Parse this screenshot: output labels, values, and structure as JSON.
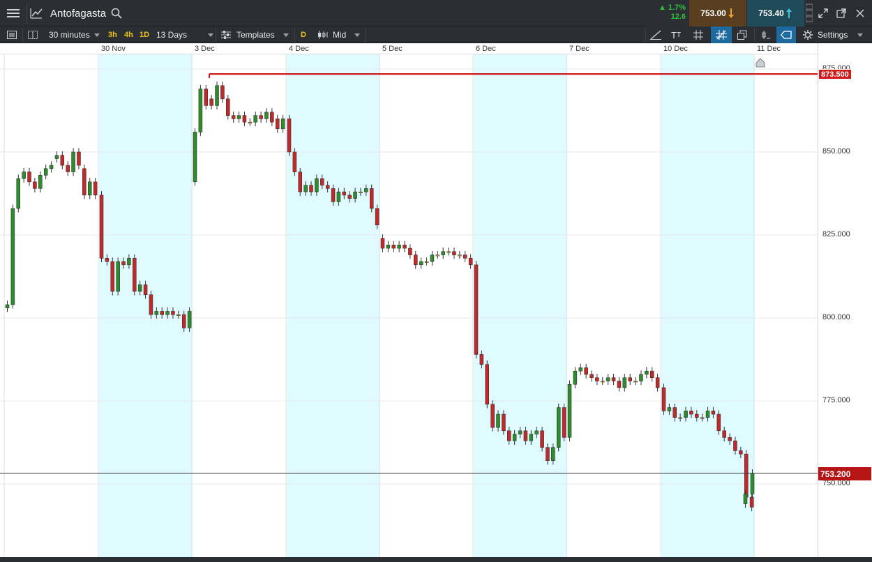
{
  "header": {
    "instrument": "Antofagasta",
    "change_pct": "▲ 1.7%",
    "change_abs": "12.6",
    "sell_price": "753.00",
    "buy_price": "753.40"
  },
  "toolbar": {
    "interval": "30 minutes",
    "quick_3h": "3h",
    "quick_4h": "4h",
    "quick_1d": "1D",
    "range": "13 Days",
    "templates": "Templates",
    "d_badge": "D",
    "price_type": "Mid",
    "settings": "Settings"
  },
  "chart_data": {
    "type": "candlestick",
    "date_labels": [
      "30 Nov",
      "3 Dec",
      "4 Dec",
      "5 Dec",
      "6 Dec",
      "7 Dec",
      "10 Dec",
      "11 Dec"
    ],
    "price_ticks": [
      "875.000",
      "850.000",
      "825.000",
      "800.000",
      "775.000",
      "750.000"
    ],
    "ylim": [
      736,
      880
    ],
    "resistance_line": {
      "value": 873.5,
      "label": "873.500"
    },
    "current_price": {
      "value": 753.2,
      "label": "753.200"
    },
    "colors": {
      "up": "#2e8b2e",
      "down": "#c12a2a",
      "doji": "#e0a040",
      "shade": "#e0fbff",
      "line": "#d11a1a"
    },
    "days": [
      {
        "o": [
          803,
          804,
          833,
          842,
          844,
          841,
          839,
          843,
          845,
          848,
          849,
          846,
          844,
          850,
          845,
          837,
          841
        ],
        "c": [
          804,
          833,
          842,
          844,
          841,
          839,
          843,
          845,
          846,
          849,
          846,
          844,
          850,
          846,
          837,
          841,
          837
        ]
      },
      {
        "o": [
          837,
          818,
          817,
          808,
          817,
          816,
          818,
          808,
          810,
          807,
          801,
          802,
          801,
          802,
          801,
          801,
          797
        ],
        "c": [
          818,
          817,
          808,
          817,
          816,
          818,
          808,
          810,
          807,
          801,
          802,
          801,
          802,
          801,
          801,
          797,
          802
        ]
      },
      {
        "o": [
          841,
          856,
          869,
          866,
          864,
          870,
          866,
          861,
          860,
          861,
          859,
          859,
          861,
          860,
          862,
          860,
          857
        ],
        "c": [
          856,
          869,
          864,
          864,
          870,
          866,
          861,
          860,
          861,
          859,
          859,
          861,
          860,
          862,
          859,
          857,
          860
        ]
      },
      {
        "o": [
          860,
          850,
          844,
          838,
          840,
          838,
          842,
          840,
          839,
          835,
          838,
          837,
          836,
          838,
          838,
          839,
          833
        ],
        "c": [
          850,
          844,
          838,
          840,
          838,
          842,
          840,
          839,
          835,
          838,
          837,
          836,
          838,
          838,
          839,
          833,
          828
        ]
      },
      {
        "o": [
          824,
          821,
          822,
          821,
          822,
          821,
          819,
          816,
          817,
          817,
          819,
          819,
          820,
          820,
          819,
          819,
          818
        ],
        "c": [
          821,
          822,
          821,
          822,
          821,
          819,
          816,
          817,
          817,
          819,
          819,
          820,
          820,
          819,
          819,
          818,
          816
        ]
      },
      {
        "o": [
          816,
          789,
          786,
          774,
          767,
          771,
          766,
          763,
          765,
          766,
          763,
          765,
          766,
          761,
          757,
          761,
          773
        ],
        "c": [
          789,
          786,
          774,
          767,
          771,
          766,
          763,
          765,
          766,
          763,
          765,
          766,
          761,
          757,
          761,
          773,
          764
        ]
      },
      {
        "o": [
          764,
          780,
          784,
          785,
          783,
          782,
          781,
          781,
          782,
          781,
          779,
          782,
          781,
          781,
          783,
          784,
          782
        ],
        "c": [
          780,
          784,
          785,
          783,
          782,
          781,
          781,
          782,
          781,
          779,
          782,
          781,
          781,
          783,
          784,
          782,
          779
        ]
      },
      {
        "o": [
          779,
          772,
          773,
          770,
          770,
          772,
          771,
          770,
          770,
          772,
          771,
          766,
          764,
          763,
          760,
          759,
          746
        ],
        "c": [
          772,
          773,
          770,
          770,
          772,
          771,
          770,
          770,
          772,
          771,
          766,
          764,
          763,
          760,
          759,
          746,
          743
        ]
      }
    ],
    "last_day": {
      "o": [
        744,
        747
      ],
      "c": [
        747,
        753.2
      ]
    }
  }
}
